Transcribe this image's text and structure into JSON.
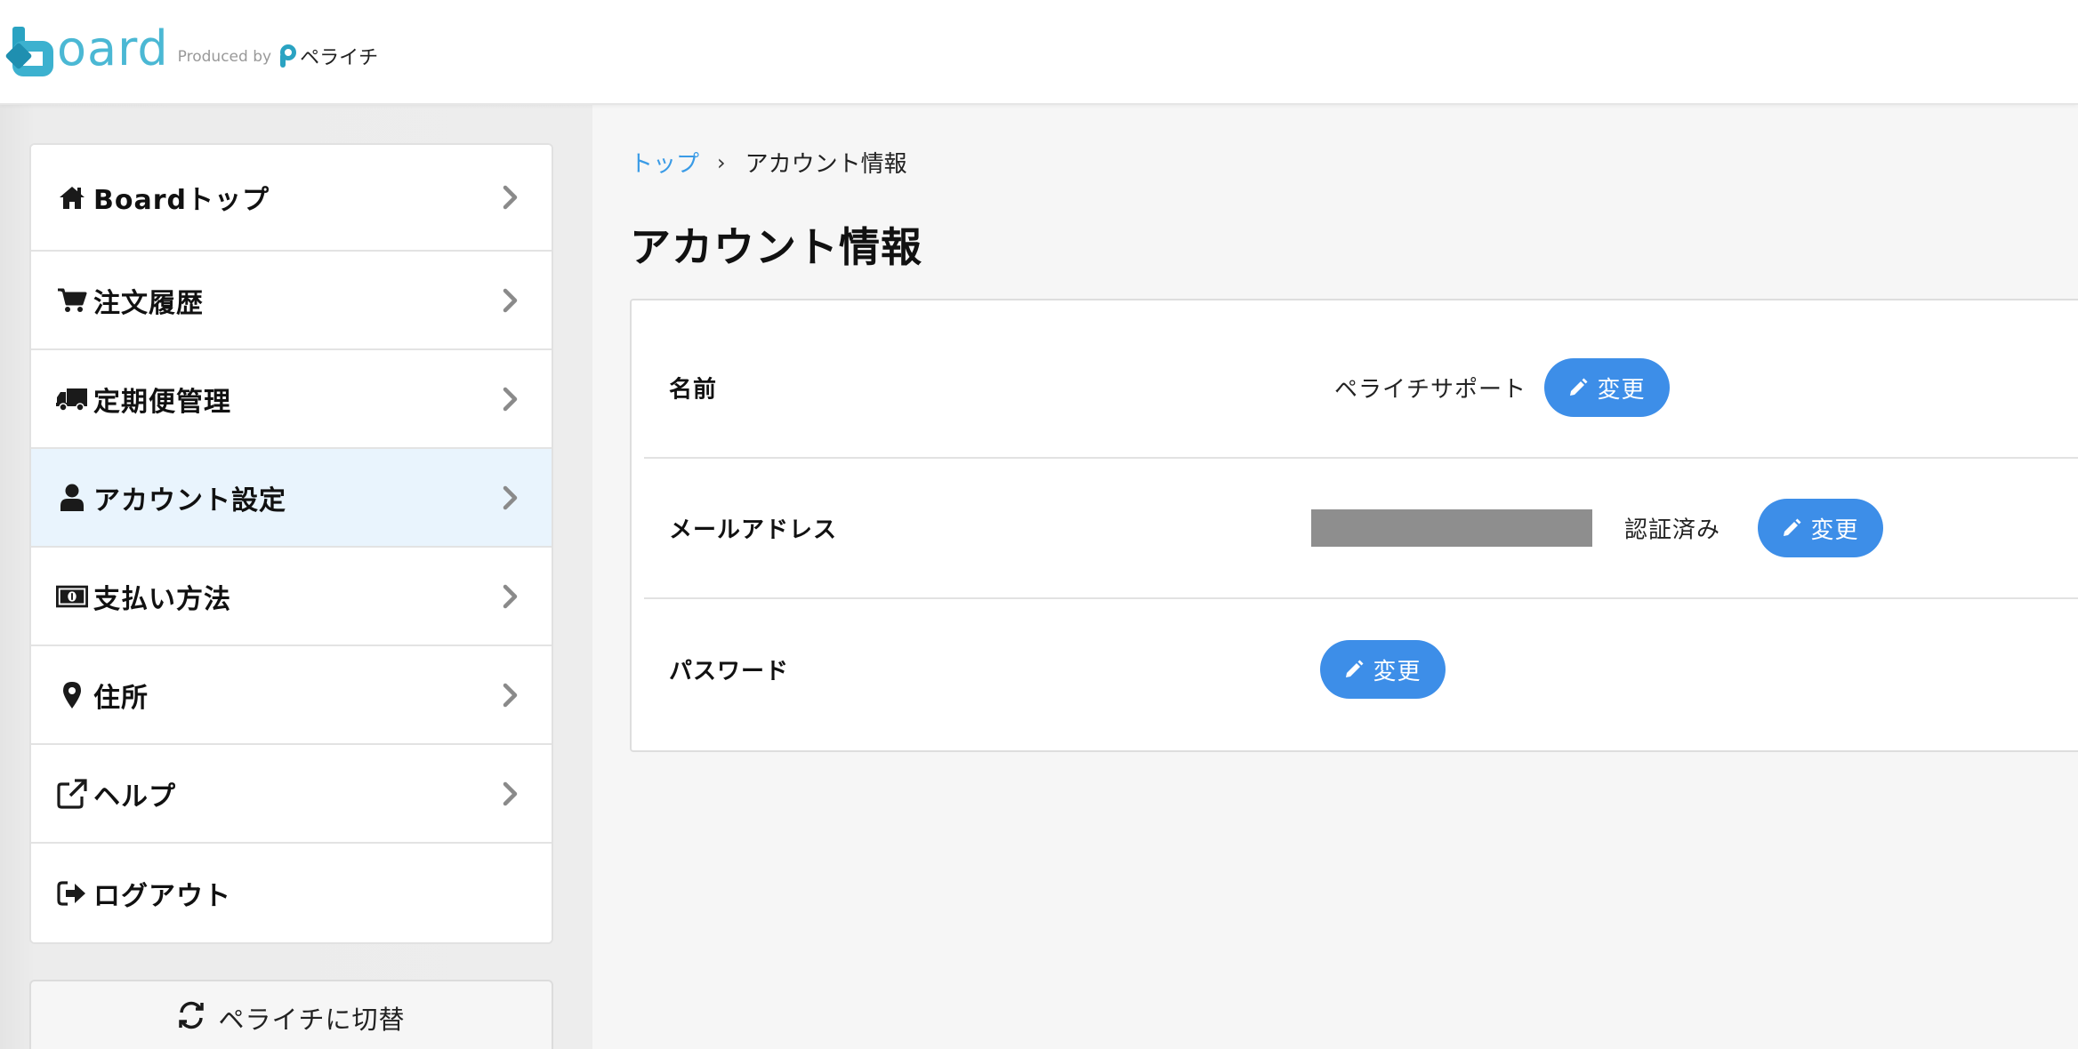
{
  "header": {
    "logo_text": "oard",
    "produced_by": "Produced by",
    "brand_name": "ペライチ"
  },
  "sidebar": {
    "items": [
      {
        "label": "Boardトップ",
        "icon": "home-icon"
      },
      {
        "label": "注文履歴",
        "icon": "cart-icon"
      },
      {
        "label": "定期便管理",
        "icon": "truck-icon"
      },
      {
        "label": "アカウント設定",
        "icon": "user-icon",
        "active": true
      },
      {
        "label": "支払い方法",
        "icon": "money-icon"
      },
      {
        "label": "住所",
        "icon": "map-marker-icon"
      },
      {
        "label": "ヘルプ",
        "icon": "external-link-icon"
      },
      {
        "label": "ログアウト",
        "icon": "sign-out-icon"
      }
    ],
    "switch_label": "ペライチに切替"
  },
  "breadcrumb": {
    "top": "トップ",
    "separator": "›",
    "current": "アカウント情報"
  },
  "page": {
    "title": "アカウント情報"
  },
  "account": {
    "name_label": "名前",
    "name_value": "ペライチサポート",
    "email_label": "メールアドレス",
    "email_status": "認証済み",
    "password_label": "パスワード",
    "change_label": "変更"
  },
  "colors": {
    "accent": "#3d8ee8",
    "link": "#3a9be6",
    "active_bg": "#e9f4fd",
    "logo": "#4bb8d4"
  }
}
